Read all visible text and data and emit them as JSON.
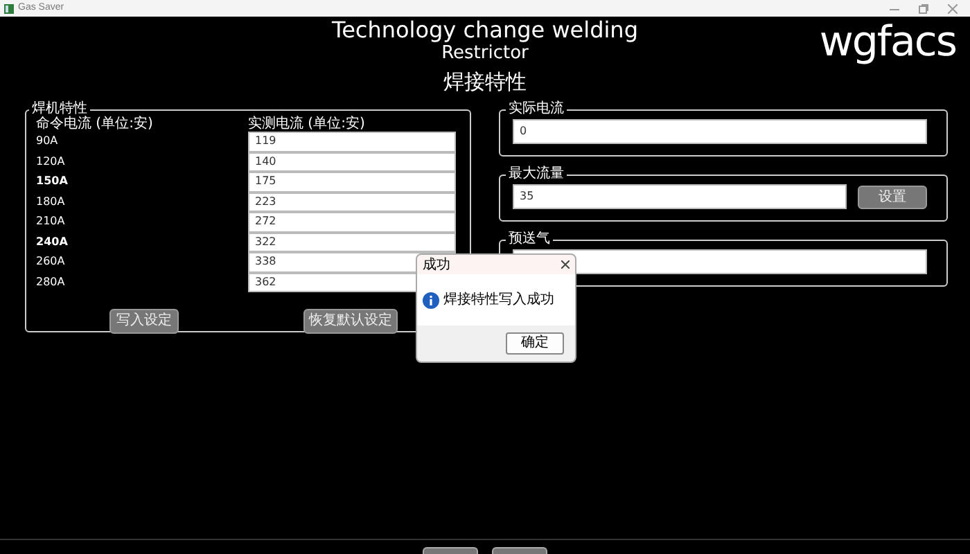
{
  "window": {
    "title": "Gas Saver"
  },
  "header": {
    "title": "Technology change welding",
    "subtitle": "Restrictor",
    "section": "焊接特性",
    "logo": "wgfacs"
  },
  "welder_panel": {
    "legend": "焊机特性",
    "column_1": "命令电流 (单位:安)",
    "column_2": "实测电流 (单位:安)",
    "rows": [
      {
        "command": "90A",
        "measured": "119",
        "emphasized": false
      },
      {
        "command": "120A",
        "measured": "140",
        "emphasized": false
      },
      {
        "command": "150A",
        "measured": "175",
        "emphasized": true
      },
      {
        "command": "180A",
        "measured": "223",
        "emphasized": false
      },
      {
        "command": "210A",
        "measured": "272",
        "emphasized": false
      },
      {
        "command": "240A",
        "measured": "322",
        "emphasized": true
      },
      {
        "command": "260A",
        "measured": "338",
        "emphasized": false
      },
      {
        "command": "280A",
        "measured": "362",
        "emphasized": false
      }
    ],
    "buttons": [
      "写入设定",
      "恢复默认设定"
    ]
  },
  "actual_current": {
    "legend": "实际电流",
    "value": "0"
  },
  "max_flow": {
    "legend": "最大流量",
    "value": "35",
    "button": "设置"
  },
  "pre_gas": {
    "legend": "预送气"
  },
  "dialog": {
    "title": "成功",
    "message": "焊接特性写入成功",
    "button": "确定"
  }
}
